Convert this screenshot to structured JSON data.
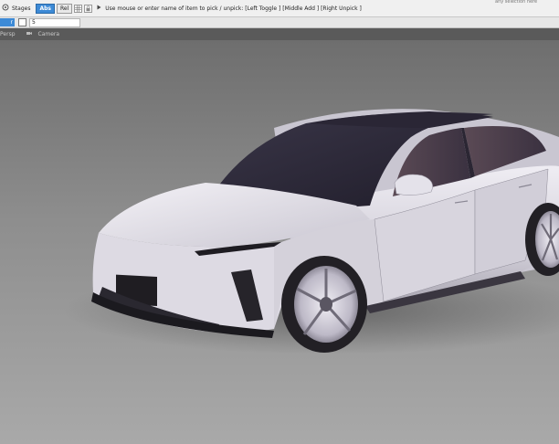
{
  "toolbar": {
    "stages_label": "Stages",
    "abs_label": "Abs",
    "rel_label": "Rel",
    "prompt_text": "Use mouse or enter name of item to pick / unpick: [Left Toggle ] [Middle Add ] [Right Unpick ]",
    "right_clip_text": "any selection here"
  },
  "toolbar2": {
    "blue_tab_label": "r",
    "value": "5"
  },
  "tabs": [
    {
      "label": "Persp"
    },
    {
      "label": "Camera"
    }
  ],
  "icons": {
    "stages": "stages-icon",
    "grid": "grid-icon",
    "lock": "lock-icon",
    "arrow": "play-arrow-icon",
    "checkbox": "checkbox-icon",
    "camera": "camera-icon"
  },
  "colors": {
    "viewport_top": "#6f6f6f",
    "viewport_bottom": "#a7a7a7",
    "accent": "#3d8ad6",
    "car_body": "#d9d6e0",
    "glass": "#2d2a3a"
  }
}
